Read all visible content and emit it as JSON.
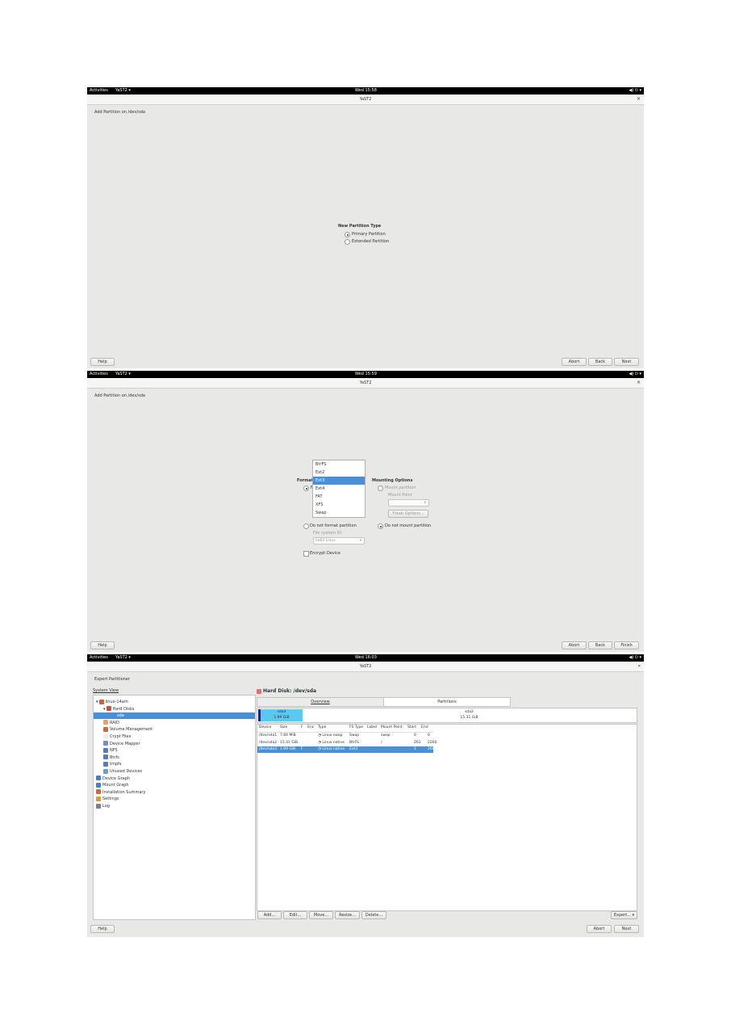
{
  "topbar": {
    "activities": "Activities",
    "app_menu": "YaST2 ▾",
    "tray": "◀) ⏻ ▾"
  },
  "shot1": {
    "time": "Wed 15:58",
    "title": "YaST2",
    "close": "×",
    "header": "Add Partition on /dev/sda",
    "group_title": "New Partition Type",
    "options": [
      "Primary Partition",
      "Extended Partition"
    ],
    "buttons": {
      "help": "Help",
      "abort": "Abort",
      "back": "Back",
      "next": "Next"
    }
  },
  "shot2": {
    "time": "Wed 15:59",
    "title": "YaST2",
    "close": "×",
    "header": "Add Partition on /dev/sda",
    "formatting_title": "Formatting Options",
    "format_radio_label": "F",
    "fs_dropdown_options": [
      "BtrFS",
      "Ext2",
      "Ext3",
      "Ext4",
      "FAT",
      "XFS",
      "Swap"
    ],
    "fs_selected": "Ext3",
    "do_not_format": "Do not format partition",
    "fs_id_label": "File system ID:",
    "fs_id_value": "0x83 Linux",
    "encrypt": "Encrypt Device",
    "mounting_title": "Mounting Options",
    "mount_partition": "Mount partition",
    "mount_point_label": "Mount Point",
    "fstab_options": "Fstab Options...",
    "do_not_mount": "Do not mount partition",
    "buttons": {
      "help": "Help",
      "abort": "Abort",
      "back": "Back",
      "finish": "Finish"
    }
  },
  "shot3": {
    "time": "Wed 16:03",
    "title": "YaST2",
    "close": "«",
    "header": "Expert Partitioner",
    "system_view": "System View",
    "tree": [
      {
        "label": "linux-14am",
        "indent": 0
      },
      {
        "label": "Hard Disks",
        "indent": 1
      },
      {
        "label": "sda",
        "indent": 2,
        "selected": true
      },
      {
        "label": "RAID",
        "indent": 1
      },
      {
        "label": "Volume Management",
        "indent": 1
      },
      {
        "label": "Crypt Files",
        "indent": 1
      },
      {
        "label": "Device Mapper",
        "indent": 1
      },
      {
        "label": "NFS",
        "indent": 1
      },
      {
        "label": "Btrfs",
        "indent": 1
      },
      {
        "label": "tmpfs",
        "indent": 1
      },
      {
        "label": "Unused Devices",
        "indent": 1
      },
      {
        "label": "Device Graph",
        "indent": 0
      },
      {
        "label": "Mount Graph",
        "indent": 0
      },
      {
        "label": "Installation Summary",
        "indent": 0
      },
      {
        "label": "Settings",
        "indent": 0
      },
      {
        "label": "Log",
        "indent": 0
      }
    ],
    "disk_title": "Hard Disk: /dev/sda",
    "tabs": [
      "Overview",
      "Partitions"
    ],
    "bar": [
      {
        "name": "sda3",
        "size": "1.99 GiB"
      },
      {
        "name": "sda2",
        "size": "15.31 GiB"
      }
    ],
    "columns": [
      "Device",
      "Size",
      "F",
      "Enc",
      "Type",
      "FS Type",
      "Label",
      "Mount Point",
      "Start",
      "End"
    ],
    "rows": [
      [
        "/dev/sda1",
        "7.84 MiB",
        "",
        "",
        "Linux swap",
        "Swap",
        "",
        "swap",
        "0",
        "0"
      ],
      [
        "/dev/sda2",
        "15.31 GiB",
        "",
        "",
        "Linux native",
        "BtrFS",
        "",
        "/",
        "261",
        "2260"
      ],
      [
        "/dev/sda3",
        "1.99 GiB",
        "F",
        "",
        "Linux native",
        "Ext3",
        "",
        "",
        "1",
        "260"
      ]
    ],
    "actions": [
      "Add...",
      "Edit...",
      "Move...",
      "Resize...",
      "Delete..."
    ],
    "expert": "Expert... ▾",
    "buttons": {
      "help": "Help",
      "abort": "Abort",
      "next": "Next"
    },
    "colors": {
      "selection": "#4a90d9",
      "bar_dark": "#1a237e",
      "bar_light": "#5bc8f0"
    }
  }
}
